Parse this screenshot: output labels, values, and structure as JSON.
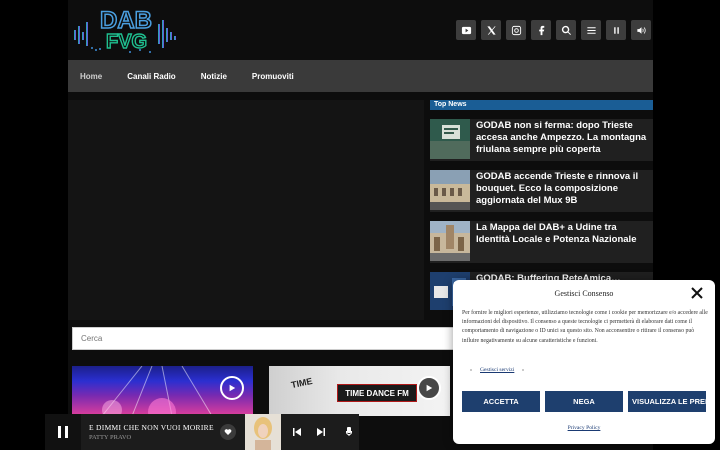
{
  "logo": {
    "text_top": "DAB",
    "text_bottom": "FVG",
    "accent": "#4a9fe0"
  },
  "social_buttons": [
    {
      "icon": "youtube-icon"
    },
    {
      "icon": "x-icon"
    },
    {
      "icon": "instagram-icon"
    },
    {
      "icon": "facebook-icon"
    },
    {
      "icon": "search-icon"
    },
    {
      "icon": "menu-icon"
    },
    {
      "icon": "pause-icon"
    },
    {
      "icon": "volume-icon"
    }
  ],
  "nav": {
    "items": [
      "Home",
      "Canali Radio",
      "Notizie",
      "Promuoviti"
    ]
  },
  "top_news": {
    "heading": "Top News",
    "items": [
      {
        "title": "GODAB non si ferma: dopo Trieste accesa anche Ampezzo. La montagna friulana sempre più coperta"
      },
      {
        "title": "GODAB accende Trieste e rinnova il bouquet. Ecco la composizione aggiornata del Mux 9B"
      },
      {
        "title": "La Mappa del DAB+ a Udine tra Identità Locale e Potenza Nazionale"
      },
      {
        "title": "GODAB: Buffering ReteAmica…"
      }
    ]
  },
  "search": {
    "placeholder": "Cerca"
  },
  "cards": [
    {
      "name": "event-stage"
    },
    {
      "name": "TIME DANCE FM",
      "overlay_text": "TIME"
    }
  ],
  "player": {
    "song": "E DIMMI CHE NON VUOI MORIRE",
    "artist": "PATTY PRAVO"
  },
  "consent": {
    "title": "Gestisci Consenso",
    "text": "Per fornire le migliori esperienze, utilizziamo tecnologie come i cookie per memorizzare e/o accedere alle informazioni del dispositivo. Il consenso a queste tecnologie ci permetterà di elaborare dati come il comportamento di navigazione o ID unici su questo sito. Non acconsentire o ritirare il consenso può influire negativamente su alcune caratteristiche e funzioni.",
    "manage_link": "Gestisci servizi",
    "accept": "ACCETTA",
    "deny": "NEGA",
    "view": "VISUALIZZA LE PREFERENZE",
    "policy": "Privacy Policy"
  }
}
